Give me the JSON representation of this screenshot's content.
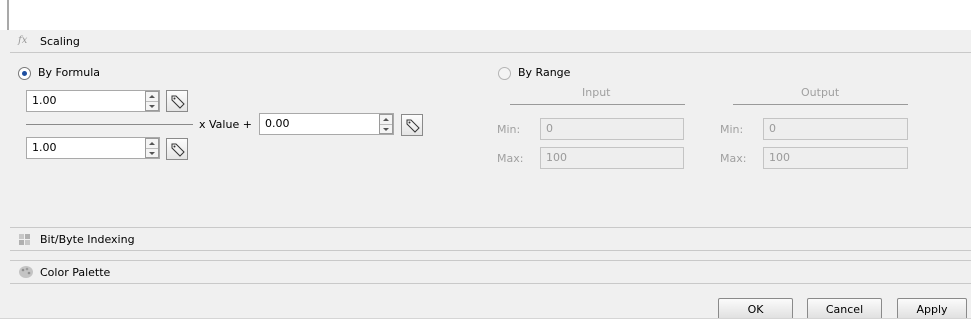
{
  "scaling": {
    "title": "Scaling",
    "icon": "function-icon"
  },
  "by_formula": {
    "label": "By Formula",
    "selected": true
  },
  "by_range": {
    "label": "By Range",
    "selected": false
  },
  "formula": {
    "multiplier": "1.00",
    "divisor": "1.00",
    "x_value_label": "x  Value  +",
    "offset": "0.00"
  },
  "range": {
    "input_header": "Input",
    "output_header": "Output",
    "min_label": "Min:",
    "max_label": "Max:",
    "input_min": "0",
    "input_max": "100",
    "output_min": "0",
    "output_max": "100"
  },
  "bit_byte": {
    "title": "Bit/Byte Indexing",
    "icon": "bit-indexing-icon"
  },
  "color_palette": {
    "title": "Color Palette",
    "icon": "palette-icon"
  },
  "buttons": {
    "ok": "OK",
    "cancel": "Cancel",
    "apply": "Apply"
  }
}
